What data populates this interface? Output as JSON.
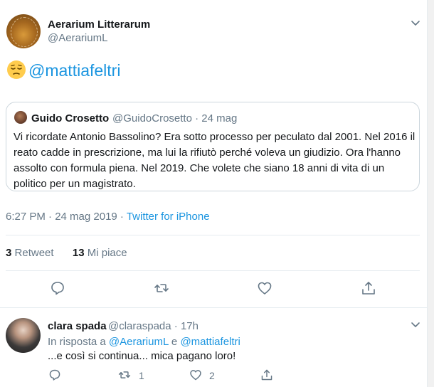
{
  "main_tweet": {
    "author_name": "Aerarium Litterarum",
    "author_handle": "@AerariumL",
    "emoji": "pensive-face",
    "text_mention": "@mattiafeltri",
    "quote": {
      "author_name": "Guido Crosetto",
      "author_handle_date": "@GuidoCrosetto · 24 mag",
      "text": "Vi ricordate Antonio Bassolino? Era sotto processo per peculato dal 2001. Nel 2016 il reato cadde in prescrizione, ma lui la rifiutò perché voleva un giudizio. Ora l'hanno assolto con formula piena. Nel 2019. Che volete che siano 18 anni di vita di un politico per un magistrato."
    },
    "timestamp": "6:27 PM · 24 mag 2019 · ",
    "source": "Twitter for iPhone",
    "retweets_count": "3",
    "retweets_label": "Retweet",
    "likes_count": "13",
    "likes_label": "Mi piace",
    "icons": [
      "reply-icon",
      "retweet-icon",
      "like-icon",
      "share-icon",
      "chevron-down-icon"
    ]
  },
  "reply_tweet": {
    "author_name": "clara spada",
    "author_handle_time": "@claraspada · 17h",
    "in_reply_prefix": "In risposta a ",
    "in_reply_user1": "@AerariumL",
    "in_reply_and": " e ",
    "in_reply_user2": "@mattiafeltri",
    "text": "...e così si continua... mica pagano loro!",
    "retweet_count": "1",
    "like_count": "2"
  },
  "colors": {
    "accent": "#1b95e0",
    "secondary_text": "#657786",
    "border": "#e6ecf0"
  }
}
